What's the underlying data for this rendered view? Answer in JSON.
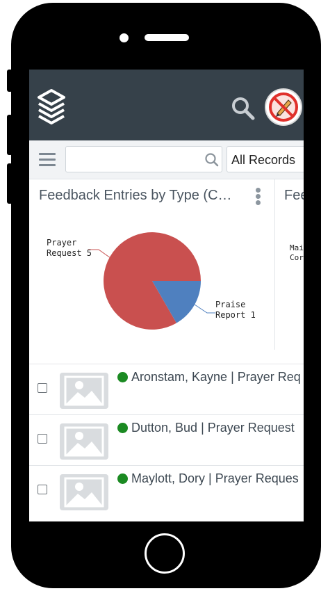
{
  "colors": {
    "appbar": "#36414a",
    "status_active": "#1b8a22",
    "pie_prayer": "#c9504f",
    "pie_praise": "#4f80bf"
  },
  "appbar": {
    "logo_icon": "layers-icon",
    "search_icon": "search-icon",
    "avatar_icon": "no-editing-icon"
  },
  "toolbar": {
    "menu_icon": "hamburger-icon",
    "search_placeholder": "",
    "search_value": "",
    "records_filter": "All Records"
  },
  "cards": [
    {
      "title": "Feedback Entries by Type (C…"
    },
    {
      "title": "Fee",
      "legend": [
        "Mai",
        "Cor"
      ]
    }
  ],
  "chart_data": {
    "type": "pie",
    "title": "",
    "labels": [
      "Prayer Request",
      "Praise Report"
    ],
    "values": [
      5,
      1
    ],
    "colors": [
      "#c9504f",
      "#4f80bf"
    ],
    "label_lines": [
      "Prayer",
      "Request 5",
      "Praise",
      "Report 1"
    ]
  },
  "rows": [
    {
      "title": "Aronstam, Kayne | Prayer Req",
      "status": "active"
    },
    {
      "title": "Dutton, Bud | Prayer Request",
      "status": "active"
    },
    {
      "title": "Maylott, Dory | Prayer Reques",
      "status": "active"
    }
  ]
}
